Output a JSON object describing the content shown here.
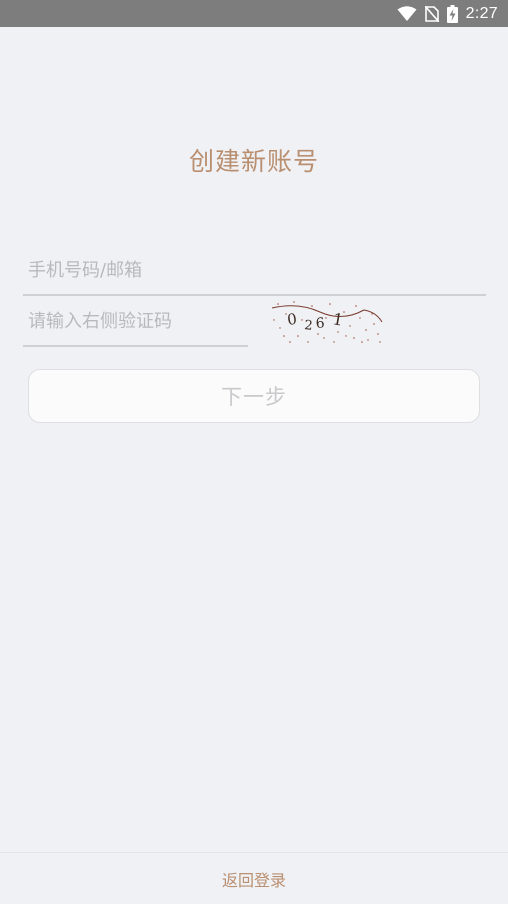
{
  "status_bar": {
    "time": "2:27",
    "icons": [
      "wifi-icon",
      "no-sim-icon",
      "battery-charging-icon"
    ]
  },
  "header": {
    "title": "创建新账号"
  },
  "form": {
    "phone_placeholder": "手机号码/邮箱",
    "captcha_placeholder": "请输入右侧验证码",
    "captcha_text": "0261",
    "next_label": "下一步"
  },
  "footer": {
    "back_login_label": "返回登录"
  },
  "colors": {
    "accent": "#b98f70",
    "background": "#f0f1f5",
    "status_bar": "#7d7d7d",
    "button_text_disabled": "#c9c9cc"
  }
}
